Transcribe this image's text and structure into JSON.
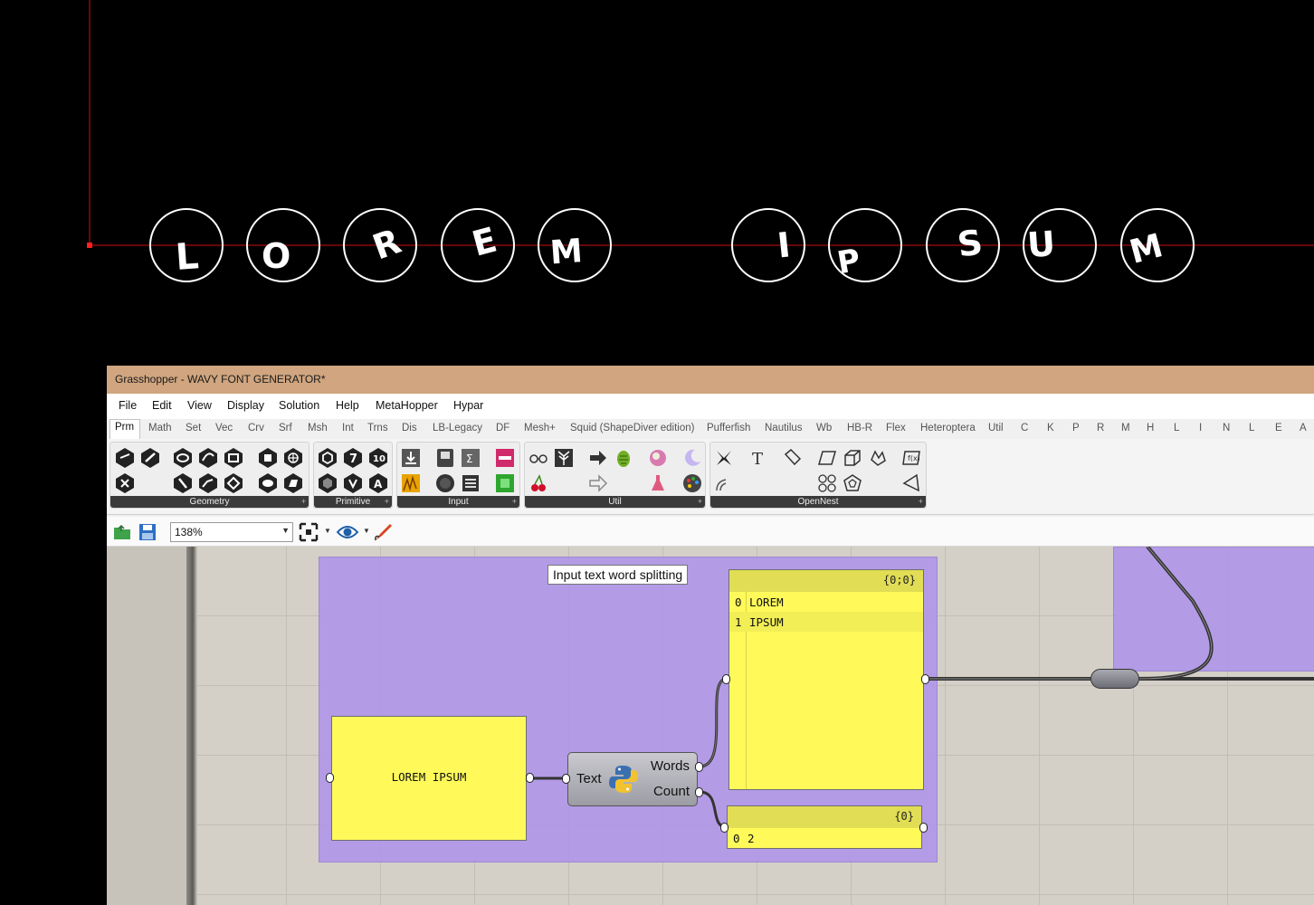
{
  "viewport": {
    "letters": [
      "L",
      "O",
      "R",
      "E",
      "M",
      "I",
      "P",
      "S",
      "U",
      "M"
    ]
  },
  "window": {
    "title": "Grasshopper - WAVY FONT GENERATOR*"
  },
  "menu": [
    "File",
    "Edit",
    "View",
    "Display",
    "Solution",
    "Help",
    "MetaHopper",
    "Hypar"
  ],
  "tabs": [
    "Prm",
    "Math",
    "Set",
    "Vec",
    "Crv",
    "Srf",
    "Msh",
    "Int",
    "Trns",
    "Dis",
    "LB-Legacy",
    "DF",
    "Mesh+",
    "Squid (ShapeDiver edition)",
    "Pufferfish",
    "Nautilus",
    "Wb",
    "HB-R",
    "Flex",
    "Heteroptera",
    "Util",
    "C",
    "K",
    "P",
    "R",
    "M",
    "H",
    "L",
    "I",
    "N",
    "L",
    "E",
    "A"
  ],
  "ribbon_panels": [
    "Geometry",
    "Primitive",
    "Input",
    "Util",
    "OpenNest"
  ],
  "toolbar": {
    "zoom": "138%"
  },
  "canvas": {
    "tooltip": "Input text word splitting",
    "input_panel_text": "LOREM IPSUM",
    "python": {
      "input": "Text",
      "output1": "Words",
      "output2": "Count"
    },
    "words_panel": {
      "path": "{0;0}",
      "rows": [
        {
          "index": "0",
          "value": "LOREM"
        },
        {
          "index": "1",
          "value": "IPSUM"
        }
      ]
    },
    "count_panel": {
      "path": "{0}",
      "rows": [
        {
          "index": "0",
          "value": "2"
        }
      ]
    }
  },
  "colors": {
    "group": "#b096e8",
    "panel": "#fffa5a",
    "titlebar": "#d0a57f",
    "axis": "#cc1111"
  }
}
